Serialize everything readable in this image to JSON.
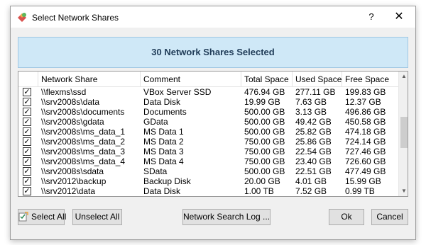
{
  "window": {
    "title": "Select Network Shares",
    "help_label": "?",
    "close_label": "✕"
  },
  "banner": {
    "text": "30 Network Shares Selected"
  },
  "table": {
    "headers": {
      "share": "Network Share",
      "comment": "Comment",
      "total": "Total Space",
      "used": "Used Space",
      "free": "Free Space"
    },
    "rows": [
      {
        "checked": true,
        "share": "\\\\flexms\\ssd",
        "comment": "VBox Server SSD",
        "total": "476.94 GB",
        "used": "277.11 GB",
        "free": "199.83 GB"
      },
      {
        "checked": true,
        "share": "\\\\srv2008s\\data",
        "comment": "Data Disk",
        "total": "19.99 GB",
        "used": "7.63 GB",
        "free": "12.37 GB"
      },
      {
        "checked": true,
        "share": "\\\\srv2008s\\documents",
        "comment": "Documents",
        "total": "500.00 GB",
        "used": "3.13 GB",
        "free": "496.86 GB"
      },
      {
        "checked": true,
        "share": "\\\\srv2008s\\gdata",
        "comment": "GData",
        "total": "500.00 GB",
        "used": "49.42 GB",
        "free": "450.58 GB"
      },
      {
        "checked": true,
        "share": "\\\\srv2008s\\ms_data_1",
        "comment": "MS Data 1",
        "total": "500.00 GB",
        "used": "25.82 GB",
        "free": "474.18 GB"
      },
      {
        "checked": true,
        "share": "\\\\srv2008s\\ms_data_2",
        "comment": "MS Data 2",
        "total": "750.00 GB",
        "used": "25.86 GB",
        "free": "724.14 GB"
      },
      {
        "checked": true,
        "share": "\\\\srv2008s\\ms_data_3",
        "comment": "MS Data 3",
        "total": "750.00 GB",
        "used": "22.54 GB",
        "free": "727.46 GB"
      },
      {
        "checked": true,
        "share": "\\\\srv2008s\\ms_data_4",
        "comment": "MS Data 4",
        "total": "750.00 GB",
        "used": "23.40 GB",
        "free": "726.60 GB"
      },
      {
        "checked": true,
        "share": "\\\\srv2008s\\sdata",
        "comment": "SData",
        "total": "500.00 GB",
        "used": "22.51 GB",
        "free": "477.49 GB"
      },
      {
        "checked": true,
        "share": "\\\\srv2012\\backup",
        "comment": "Backup Disk",
        "total": "20.00 GB",
        "used": "4.01 GB",
        "free": "15.99 GB"
      },
      {
        "checked": true,
        "share": "\\\\srv2012\\data",
        "comment": "Data Disk",
        "total": "1.00 TB",
        "used": "7.52 GB",
        "free": "0.99 TB"
      }
    ]
  },
  "buttons": {
    "select_all": "Select All",
    "unselect_all": "Unselect All",
    "search_log": "Network Search Log ...",
    "ok": "Ok",
    "cancel": "Cancel"
  },
  "icons": {
    "app": "network-shares-icon",
    "select_all": "checklist-icon"
  },
  "colors": {
    "banner_bg": "#cfe8f7",
    "banner_text": "#1f3b57"
  }
}
